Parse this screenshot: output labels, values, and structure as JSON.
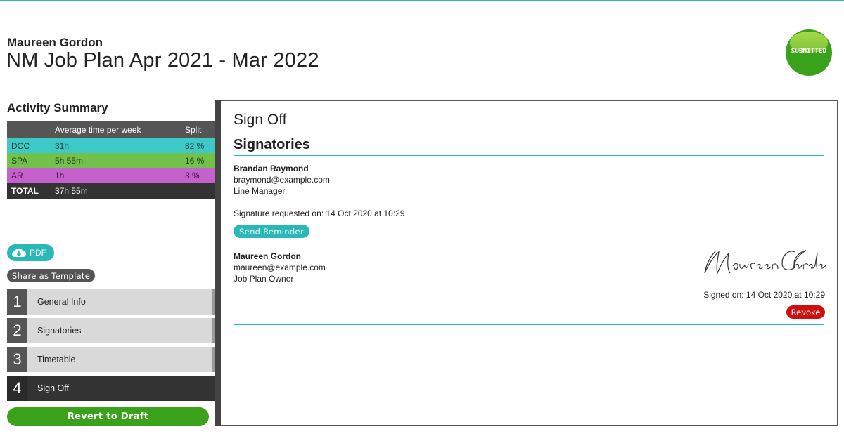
{
  "header": {
    "user_name": "Maureen Gordon",
    "plan_title": "NM Job Plan Apr 2021 - Mar 2022",
    "status_badge": "SUBMITTED"
  },
  "activity_summary": {
    "title": "Activity Summary",
    "columns": [
      "",
      "Average time per week",
      "Split"
    ],
    "rows": [
      {
        "code": "DCC",
        "time": "31h",
        "split": "82 %"
      },
      {
        "code": "SPA",
        "time": "5h 55m",
        "split": "16 %"
      },
      {
        "code": "AR",
        "time": "1h",
        "split": "3 %"
      }
    ],
    "total": {
      "label": "TOTAL",
      "time": "37h 55m"
    }
  },
  "actions": {
    "pdf_label": "PDF",
    "template_label": "Share as Template",
    "revert_label": "Revert to Draft"
  },
  "steps": [
    {
      "num": "1",
      "label": "General Info"
    },
    {
      "num": "2",
      "label": "Signatories"
    },
    {
      "num": "3",
      "label": "Timetable"
    },
    {
      "num": "4",
      "label": "Sign Off"
    }
  ],
  "signoff": {
    "title": "Sign Off",
    "section_title": "Signatories",
    "signatories": [
      {
        "name": "Brandan Raymond",
        "email": "braymond@example.com",
        "role": "Line Manager",
        "status_text": "Signature requested on: 14 Oct 2020 at 10:29",
        "action_label": "Send Reminder"
      },
      {
        "name": "Maureen Gordon",
        "email": "maureen@example.com",
        "role": "Job Plan Owner",
        "signature_text": "Maureen Gordon",
        "status_text": "Signed on: 14 Oct 2020 at 10:29",
        "action_label": "Revoke"
      }
    ]
  },
  "colors": {
    "accent": "#28b8b8",
    "dcc": "#3ec9c9",
    "spa": "#72c14a",
    "ar": "#c561cc",
    "success": "#3aa21a",
    "danger": "#cc1010"
  },
  "icons": [
    "cloud-download-icon"
  ]
}
